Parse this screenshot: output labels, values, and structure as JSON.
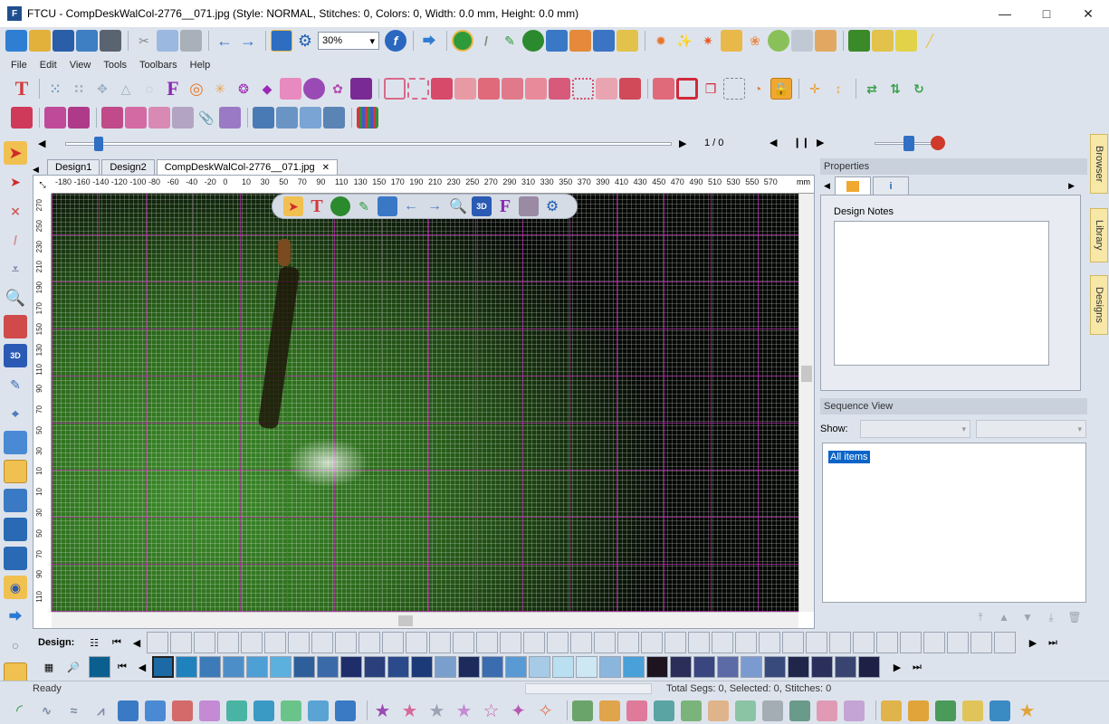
{
  "window": {
    "title": "FTCU - CompDeskWalCol-2776__071.jpg (Style: NORMAL, Stitches: 0, Colors: 0, Width: 0.0 mm, Height: 0.0 mm)",
    "app_icon": "F"
  },
  "menu": [
    "File",
    "Edit",
    "View",
    "Tools",
    "Toolbars",
    "Help"
  ],
  "toolbar": {
    "zoom_value": "30%"
  },
  "slider": {
    "page_counter": "1 / 0"
  },
  "tabs": [
    "Design1",
    "Design2",
    "CompDeskWalCol-2776__071.jpg"
  ],
  "ruler": {
    "unit": "mm",
    "h_labels": [
      "-180",
      "-160",
      "-140",
      "-120",
      "-100",
      "-80",
      "-60",
      "-40",
      "-20",
      "0",
      "10",
      "30",
      "50",
      "70",
      "90",
      "110",
      "130",
      "150",
      "170",
      "190",
      "210",
      "230",
      "250",
      "270",
      "290",
      "310",
      "330",
      "350",
      "370",
      "390",
      "410",
      "430",
      "450",
      "470",
      "490",
      "510",
      "530",
      "550",
      "570"
    ],
    "v_labels": [
      "270",
      "250",
      "230",
      "210",
      "190",
      "170",
      "150",
      "130",
      "110",
      "90",
      "70",
      "50",
      "30",
      "10",
      "10",
      "30",
      "50",
      "70",
      "90",
      "110"
    ]
  },
  "properties": {
    "header": "Properties",
    "notes_label": "Design Notes",
    "info_tab": "i"
  },
  "sequence": {
    "header": "Sequence View",
    "show_label": "Show:",
    "item": "All items"
  },
  "side_tabs": [
    "Browser",
    "Library",
    "Designs"
  ],
  "palette": {
    "design_label": "Design:",
    "thread_colors": [
      "#1b6aa6",
      "#1f82bd",
      "#3c7ab8",
      "#4e8ec8",
      "#4d9fd6",
      "#5bb0de",
      "#2f5f9a",
      "#3b6aa8",
      "#1f2d6a",
      "#2a3f7c",
      "#2a4a8c",
      "#1c3a78",
      "#7a9fcc",
      "#1d2a5c",
      "#3b6cb0",
      "#5a9ad4",
      "#a7cbe6",
      "#b9dff0",
      "#cde8f2",
      "#8ab6de",
      "#4aa0d8",
      "#1d1420",
      "#2b2e58",
      "#3a4680",
      "#5c6aa6",
      "#7b9bd0",
      "#384a7c",
      "#20264a",
      "#2a2f5c",
      "#3a4470",
      "#1e2046"
    ],
    "design_color": "#0b5f8f"
  },
  "status": {
    "ready": "Ready",
    "totals": "Total Segs: 0, Selected: 0, Stitches: 0"
  }
}
